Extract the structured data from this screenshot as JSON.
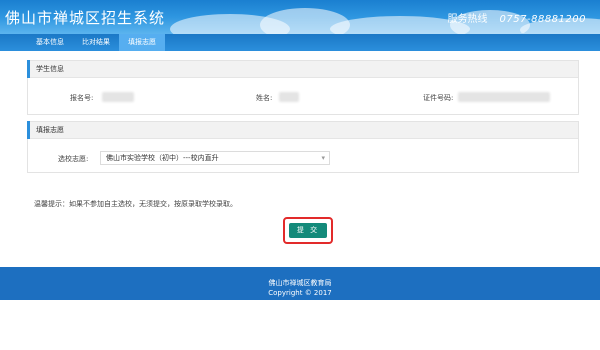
{
  "header": {
    "title": "佛山市禅城区招生系统",
    "hotline_label": "服务热线",
    "hotline_number": "0757-88881200"
  },
  "nav": {
    "tabs": [
      {
        "label": "基本信息"
      },
      {
        "label": "比对结果"
      },
      {
        "label": "填报志愿"
      }
    ],
    "active_index": 2
  },
  "student_info": {
    "heading": "学生信息",
    "reg_no_label": "报名号:",
    "name_label": "姓名:",
    "id_label": "证件号码:"
  },
  "application": {
    "heading": "填报志愿",
    "choice_label": "选校志愿:",
    "choice_value": "佛山市实验学校（初中）---校内直升"
  },
  "hint": "温馨提示：如果不参加自主选校，无须提交，按原录取学校录取。",
  "submit_label": "提 交",
  "footer": {
    "line1": "佛山市禅城区教育局",
    "line2": "Copyright © 2017"
  },
  "colors": {
    "header_blue": "#2e96e0",
    "nav_active": "#56aef0",
    "submit_green": "#138a7a",
    "highlight_red": "#e22a2a",
    "footer_blue": "#1d6fc0"
  }
}
